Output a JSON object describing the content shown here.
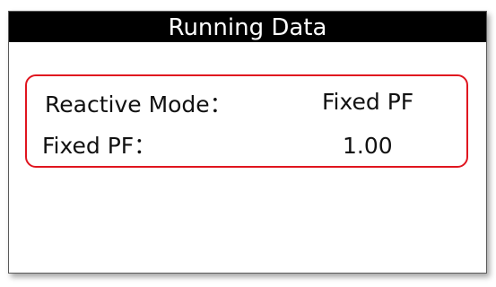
{
  "header": {
    "title": "Running Data"
  },
  "running_data": {
    "rows": [
      {
        "label": "Reactive Mode：",
        "value": "Fixed PF"
      },
      {
        "label": "Fixed PF：",
        "value": "1.00"
      }
    ]
  },
  "colors": {
    "title_bar_background": "#000000",
    "title_text": "#ffffff",
    "highlight_border": "#e0151f"
  }
}
